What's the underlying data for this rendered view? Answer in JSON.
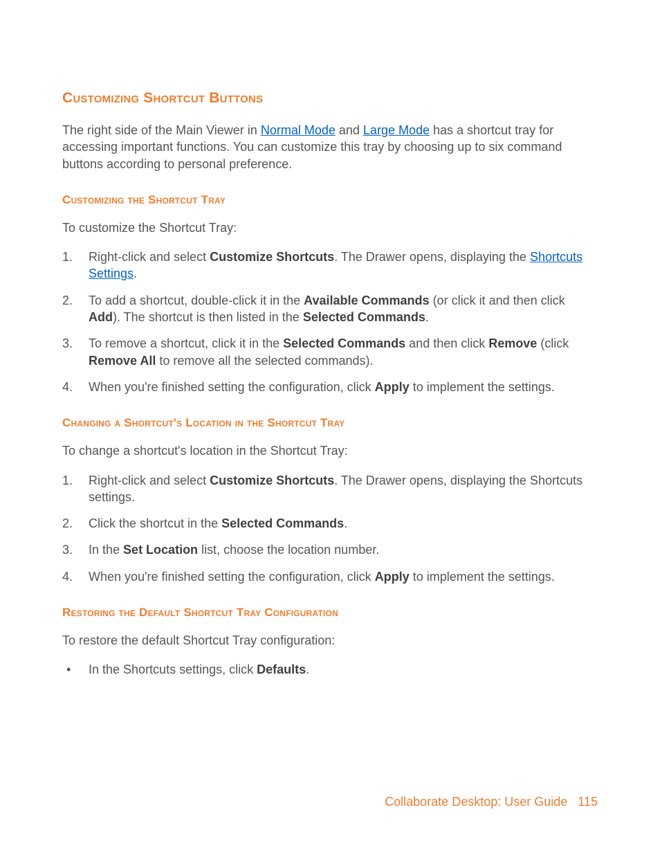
{
  "sections": {
    "main_heading": "Customizing Shortcut Buttons",
    "intro_a": "The right side of the Main Viewer in ",
    "link_normal": "Normal Mode",
    "intro_b": " and ",
    "link_large": "Large Mode",
    "intro_c": " has a shortcut tray for accessing important functions. You can customize this tray by choosing up to six command buttons according to personal preference.",
    "sub1_heading": "Customizing the Shortcut Tray",
    "sub1_lead": "To customize the Shortcut Tray:",
    "sub1_item1_a": "Right-click and select ",
    "sub1_item1_b_bold": "Customize Shortcuts",
    "sub1_item1_c": ". The Drawer opens, displaying the ",
    "sub1_item1_link": "Shortcuts Settings",
    "sub1_item1_d": ".",
    "sub1_item2_a": "To add a shortcut, double-click it in the ",
    "sub1_item2_b_bold": "Available Commands",
    "sub1_item2_c": " (or click it and then click ",
    "sub1_item2_d_bold": "Add",
    "sub1_item2_e": "). The shortcut is then listed in the ",
    "sub1_item2_f_bold": "Selected Commands",
    "sub1_item2_g": ".",
    "sub1_item3_a": "To remove a shortcut, click it in the ",
    "sub1_item3_b_bold": "Selected Commands",
    "sub1_item3_c": " and then click ",
    "sub1_item3_d_bold": "Remove",
    "sub1_item3_e": " (click ",
    "sub1_item3_f_bold": "Remove All",
    "sub1_item3_g": " to remove all the selected commands).",
    "sub1_item4_a": "When you're finished setting the configuration, click ",
    "sub1_item4_b_bold": "Apply",
    "sub1_item4_c": " to implement the settings.",
    "sub2_heading": "Changing a Shortcut's Location in the Shortcut Tray",
    "sub2_lead": "To change a shortcut's location in the Shortcut Tray:",
    "sub2_item1_a": "Right-click and select ",
    "sub2_item1_b_bold": "Customize Shortcuts",
    "sub2_item1_c": ". The Drawer opens, displaying the Shortcuts settings.",
    "sub2_item2_a": "Click the shortcut in the ",
    "sub2_item2_b_bold": "Selected Commands",
    "sub2_item2_c": ".",
    "sub2_item3_a": "In the ",
    "sub2_item3_b_bold": "Set Location",
    "sub2_item3_c": " list, choose the location number.",
    "sub2_item4_a": "When you're finished setting the configuration, click ",
    "sub2_item4_b_bold": "Apply",
    "sub2_item4_c": " to implement the settings.",
    "sub3_heading": "Restoring the Default Shortcut Tray Configuration",
    "sub3_lead": "To restore the default Shortcut Tray configuration:",
    "sub3_bullet_a": "In the Shortcuts settings, click ",
    "sub3_bullet_b_bold": "Defaults",
    "sub3_bullet_c": "."
  },
  "footer": {
    "title": "Collaborate Desktop: User Guide",
    "page": "115"
  }
}
